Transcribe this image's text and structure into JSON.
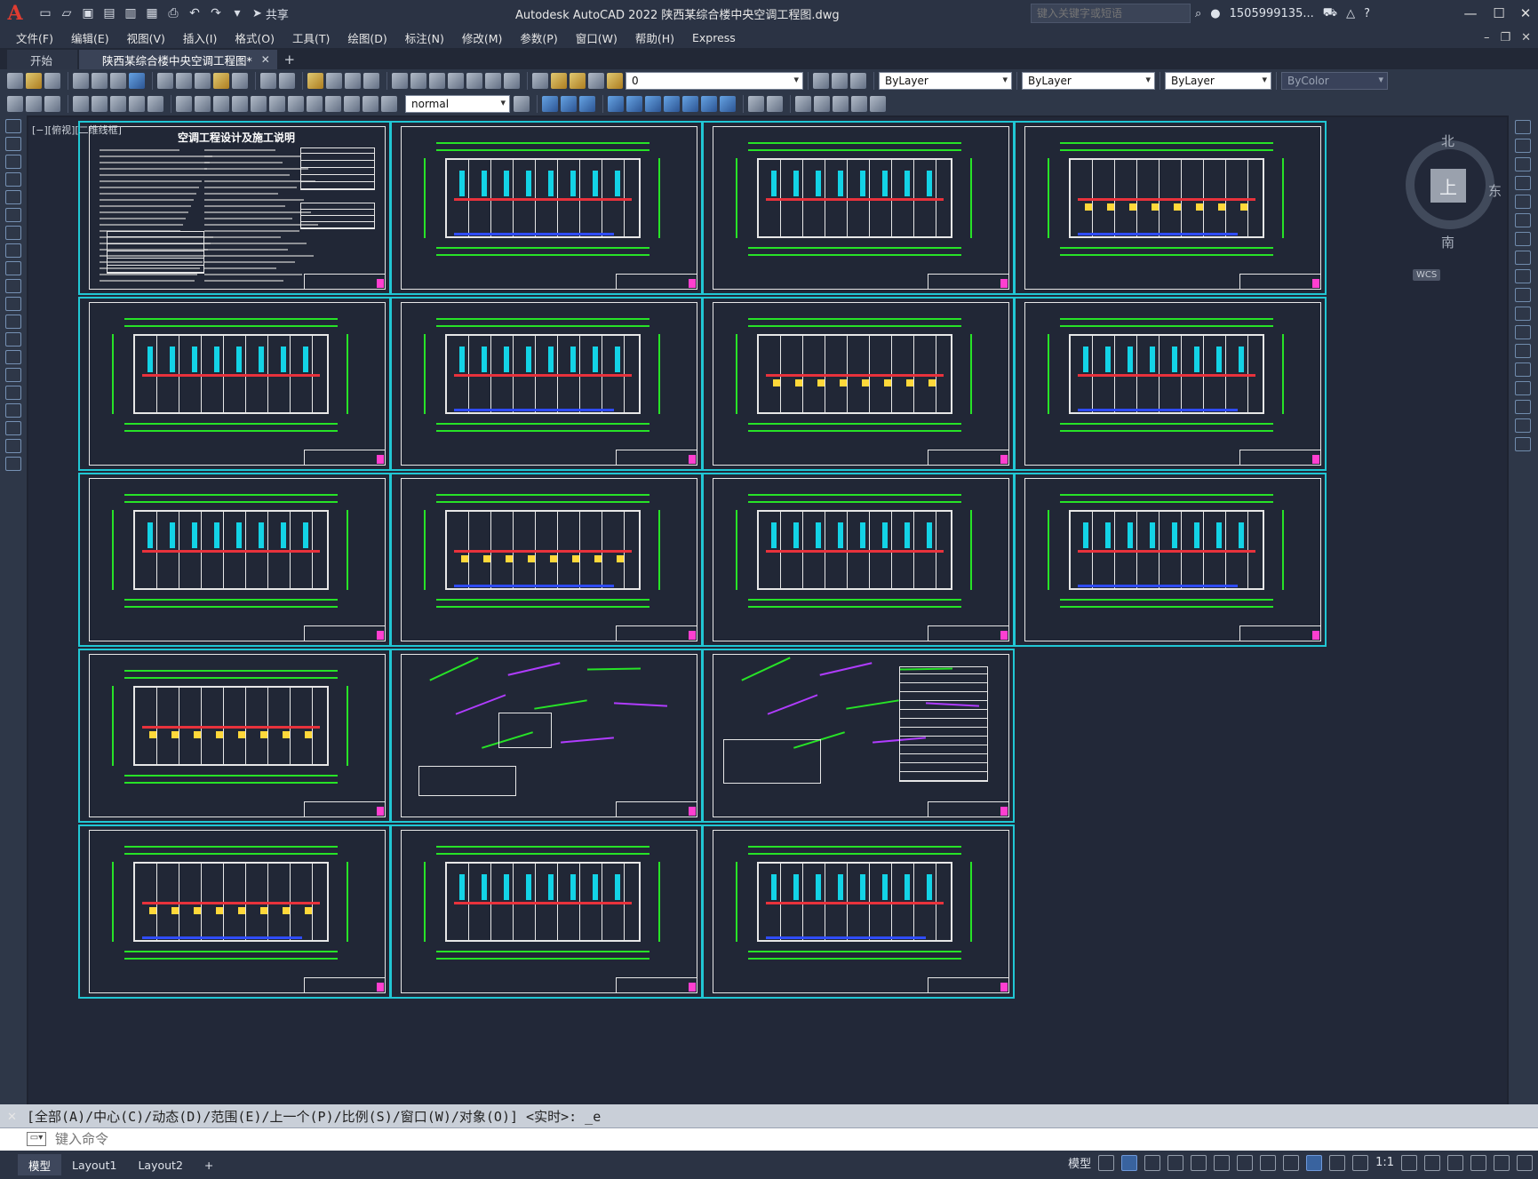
{
  "app": {
    "title": "Autodesk AutoCAD 2022    陕西某综合楼中央空调工程图.dwg",
    "share_label": "共享",
    "search_placeholder": "键入关键字或短语",
    "user": "1505999135...",
    "accent_color": "#21c7d4"
  },
  "menu": [
    "文件(F)",
    "编辑(E)",
    "视图(V)",
    "插入(I)",
    "格式(O)",
    "工具(T)",
    "绘图(D)",
    "标注(N)",
    "修改(M)",
    "参数(P)",
    "窗口(W)",
    "帮助(H)",
    "Express"
  ],
  "tabs": [
    {
      "label": "开始"
    },
    {
      "label": "陕西某综合楼中央空调工程图*"
    }
  ],
  "toolbar": {
    "layer_value": "0",
    "color_value": "ByLayer",
    "linetype_value": "ByLayer",
    "lineweight_value": "ByLayer",
    "plotstyle_value": "ByColor",
    "textstyle_value": "normal"
  },
  "viewport": {
    "label": "[−][俯视][二维线框]",
    "viewcube_face": "上",
    "north": "北",
    "south": "南",
    "east": "东",
    "wcs": "WCS"
  },
  "drawing": {
    "sheet1_title": "空调工程设计及施工说明"
  },
  "command": {
    "history": "[全部(A)/中心(C)/动态(D)/范围(E)/上一个(P)/比例(S)/窗口(W)/对象(O)] <实时>: _e",
    "placeholder": "键入命令"
  },
  "status": {
    "tabs": [
      "模型",
      "Layout1",
      "Layout2"
    ],
    "model_label": "模型",
    "scale": "1:1"
  }
}
